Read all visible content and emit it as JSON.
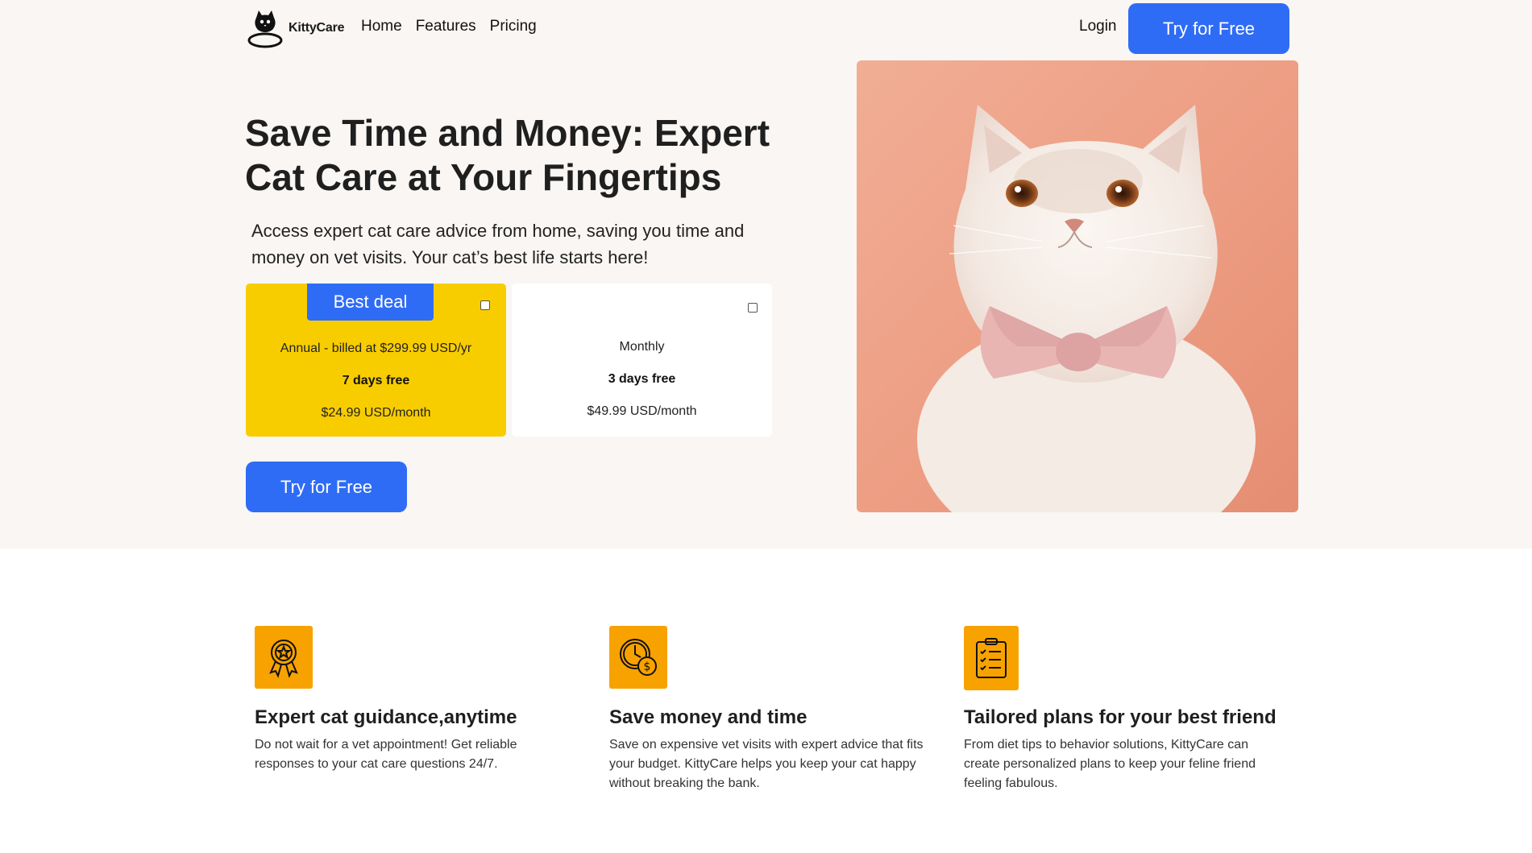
{
  "nav": {
    "logo_text": "KittyCare",
    "links": [
      "Home",
      "Features",
      "Pricing"
    ],
    "login": "Login",
    "cta": "Try for Free"
  },
  "hero": {
    "title": "Save Time and Money: Expert Cat Care at Your Fingertips",
    "subtitle": "Access expert cat care advice from home, saving you time and money on vet visits. Your cat’s best life starts here!",
    "cta": "Try for Free",
    "image_alt": "cat-with-pink-bow"
  },
  "plans": {
    "annual": {
      "badge": "Best deal",
      "billing": "Annual - billed at $299.99 USD/yr",
      "trial": "7 days free",
      "price": "$24.99 USD/month",
      "checked": false
    },
    "monthly": {
      "billing": "Monthly",
      "trial": "3 days free",
      "price": "$49.99 USD/month",
      "checked": false
    }
  },
  "features": [
    {
      "icon": "award-ribbon-icon",
      "title": "Expert cat guidance,anytime",
      "desc": "Do not wait for a vet appointment! Get reliable responses to your cat care questions 24/7."
    },
    {
      "icon": "clock-money-icon",
      "title": "Save money and time",
      "desc": "Save on expensive vet visits with expert advice that fits your budget. KittyCare helps you keep your cat happy without breaking the bank."
    },
    {
      "icon": "clipboard-checklist-icon",
      "title": "Tailored plans for your best friend",
      "desc": "From diet tips to behavior solutions, KittyCare can create personalized plans to keep your feline friend feeling fabulous."
    }
  ],
  "colors": {
    "primary": "#2f6cf6",
    "best_deal_bg": "#f8cd00",
    "feature_icon_bg": "#f8a200",
    "hero_bg": "#f9f6f3"
  }
}
